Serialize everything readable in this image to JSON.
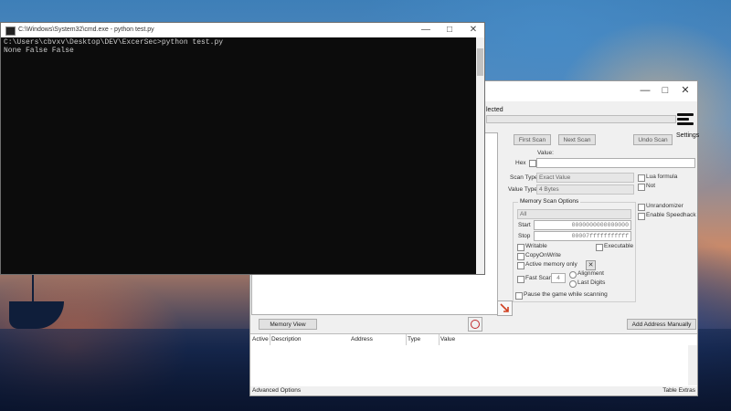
{
  "cmd": {
    "title": "C:\\Windows\\System32\\cmd.exe - python  test.py",
    "lines": [
      "C:\\Users\\cbvxv\\Desktop\\DEV\\ExcerSec>python test.py",
      "None False False"
    ]
  },
  "cheat_engine": {
    "process_status": "lected",
    "settings_label": "Settings",
    "buttons": {
      "first_scan": "First Scan",
      "next_scan": "Next Scan",
      "undo_scan": "Undo Scan",
      "memory_view": "Memory View",
      "add_address_manually": "Add Address Manually"
    },
    "value_label": "Value:",
    "hex_label": "Hex",
    "scan_type_label": "Scan Type",
    "scan_type_value": "Exact Value",
    "value_type_label": "Value Type",
    "value_type_value": "4 Bytes",
    "lua_formula": "Lua formula",
    "not_label": "Not",
    "unrandomizer": "Unrandomizer",
    "enable_speedhack": "Enable Speedhack",
    "memory_scan_options": {
      "title": "Memory Scan Options",
      "region": "All",
      "start_label": "Start",
      "start_value": "0000000000000000",
      "stop_label": "Stop",
      "stop_value": "00007fffffffffff",
      "writable": "Writable",
      "executable": "Executable",
      "copy_on_write": "CopyOnWrite",
      "active_memory_only": "Active memory only",
      "fast_scan": "Fast Scan",
      "fast_scan_value": "4",
      "alignment": "Alignment",
      "last_digits": "Last Digits",
      "pause_game": "Pause the game while scanning"
    },
    "table_headers": [
      "Active",
      "Description",
      "Address",
      "Type",
      "Value"
    ],
    "footer_left": "Advanced Options",
    "footer_right": "Table Extras"
  }
}
